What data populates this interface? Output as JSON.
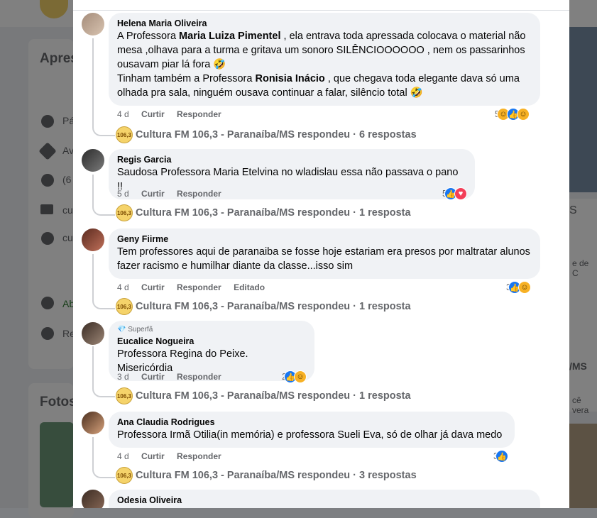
{
  "comments": [
    {
      "author": "Helena Maria Oliveira",
      "text_1": "A Professora ",
      "bold_1": "Maria Luiza Pimentel",
      "text_2": " , ela entrava toda apressada colocava o material não mesa ,olhava para a turma e gritava um sonoro SILÊNCIOOOOOO , nem os passarinhos ousavam piar lá fora 🤣",
      "text_3": "Tinham também a Professora ",
      "bold_2": "Ronisia Inácio",
      "text_4": " , que chegava toda elegante dava só uma olhada pra sala, ninguém ousava continuar a falar, silêncio total 🤣",
      "time": "4 d",
      "like": "Curtir",
      "reply": "Responder",
      "reaction_count": "5",
      "replies": "Cultura FM 106,3 - Paranaíba/MS respondeu · 6 respostas"
    },
    {
      "author": "Regis Garcia",
      "text": "Saudosa Professora Maria Etelvina no wladislau essa não passava o pano !!",
      "time": "5 d",
      "like": "Curtir",
      "reply": "Responder",
      "reaction_count": "5",
      "replies": "Cultura FM 106,3 - Paranaíba/MS respondeu · 1 resposta"
    },
    {
      "author": "Geny Fiirme",
      "text": "Tem professores aqui de paranaiba se fosse hoje estariam era presos por maltratar alunos fazer racismo e humilhar diante da classe...isso sim",
      "time": "4 d",
      "like": "Curtir",
      "reply": "Responder",
      "edited": "Editado",
      "reaction_count": "3",
      "replies": "Cultura FM 106,3 - Paranaíba/MS respondeu · 1 resposta"
    },
    {
      "badge": "Superfã",
      "author": "Eucalice Nogueira",
      "text": "Professora Regina do Peixe. Misericórdia",
      "time": "3 d",
      "like": "Curtir",
      "reply": "Responder",
      "reaction_count": "2",
      "replies": "Cultura FM 106,3 - Paranaíba/MS respondeu · 1 resposta"
    },
    {
      "author": "Ana Claudia Rodrigues",
      "text": "Professora Irmã Otilia(in memória) e professora Sueli Eva, só de olhar já dava medo",
      "time": "4 d",
      "like": "Curtir",
      "reply": "Responder",
      "reaction_count": "3",
      "replies": "Cultura FM 106,3 - Paranaíba/MS respondeu · 3 respostas"
    },
    {
      "author": "Odesia Oliveira"
    }
  ],
  "background": {
    "section_intro": "Apres",
    "section_photos": "Fotos",
    "row_1": "Pá",
    "row_2": "Av",
    "row_3": "(6",
    "row_4": "cu",
    "row_5": "cu",
    "row_6": "Ab",
    "row_7": "Re",
    "right_1": "S",
    "right_2": "e de C",
    "right_3": "/MS",
    "right_4": "cê vera"
  },
  "page_logo_text": "106,3",
  "colors": {
    "like": "#1877f2",
    "love": "#f33e58",
    "haha": "#f7b125",
    "bubble": "#f0f2f5",
    "meta": "#65676b"
  }
}
